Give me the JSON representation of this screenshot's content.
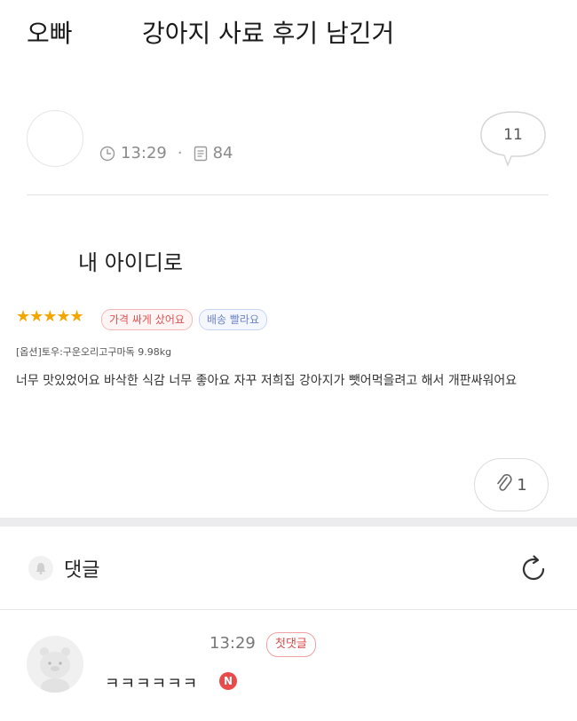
{
  "post": {
    "title_prefix": "오빠",
    "title": "강아지 사료 후기 남긴거",
    "time": "13:29",
    "view_count": "84",
    "comment_count": "11",
    "meta_separator": "·"
  },
  "content": {
    "text": "내 아이디로",
    "review": {
      "stars": "★★★★★",
      "tags": [
        "가격 싸게 샀어요",
        "배송 빨라요"
      ],
      "option": "[옵션]토우:구운오리고구마독 9.98kg",
      "text": "너무 맛있었어요 바삭한 식감 너무 좋아요 자꾸 저희집 강아지가 뺏어먹을려고 해서 개판싸워어요"
    },
    "attachment_count": "1"
  },
  "comments": {
    "label": "댓글",
    "items": [
      {
        "time": "13:29",
        "badge": "첫댓글",
        "text": "ㅋㅋㅋㅋㅋㅋ",
        "new_badge": "N"
      }
    ]
  },
  "colors": {
    "star": "#f2a600",
    "new_badge": "#e94b4b",
    "first_badge": "#e04848"
  },
  "icons": [
    "clock-icon",
    "document-icon",
    "speech-bubble-icon",
    "paperclip-icon",
    "bell-icon",
    "refresh-icon"
  ]
}
